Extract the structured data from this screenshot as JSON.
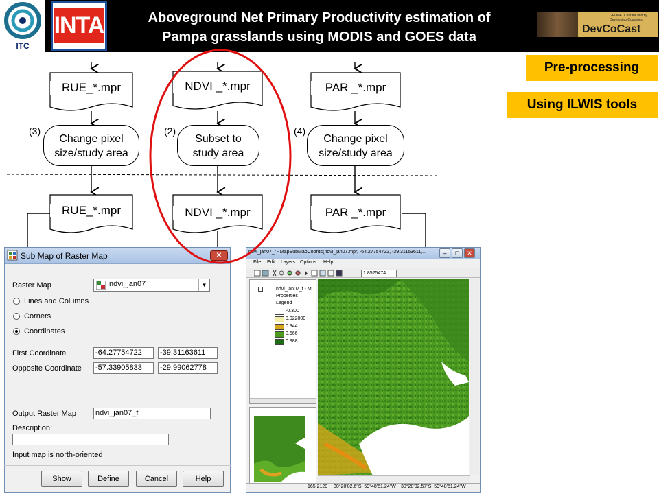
{
  "header": {
    "logo_left": "ITC",
    "logo_inta": "INTA",
    "title_line1": "Aboveground Net Primary Productivity estimation of",
    "title_line2": "Pampa grasslands using MODIS and GOES data",
    "devco_text": "DevCoCast",
    "devco_small1": "GEONETCast for and by",
    "devco_small2": "Developing Countries"
  },
  "tags": {
    "preprocessing": "Pre-processing",
    "ilwis": "Using ILWIS tools"
  },
  "flow": {
    "docs_top": [
      "RUE_*.mpr",
      "NDVI _*.mpr",
      "PAR _*.mpr"
    ],
    "process_numbers": [
      "(3)",
      "(2)",
      "(4)"
    ],
    "processes": [
      [
        "Change pixel",
        "size/study area"
      ],
      [
        "Subset  to",
        "study area"
      ],
      [
        "Change pixel",
        "size/study area"
      ]
    ],
    "docs_bottom": [
      "RUE_*.mpr",
      "NDVI _*.mpr",
      "PAR _*.mpr"
    ]
  },
  "submap": {
    "title": "Sub Map of Raster Map",
    "raster_map_label": "Raster Map",
    "raster_map_value": "ndvi_jan07",
    "radios": [
      "Lines and Columns",
      "Corners",
      "Coordinates"
    ],
    "selected_radio": 2,
    "first_coord_label": "First Coordinate",
    "first_coord_x": "-64.27754722",
    "first_coord_y": "-39.31163611",
    "opposite_coord_label": "Opposite Coordinate",
    "opposite_coord_x": "-57.33905833",
    "opposite_coord_y": "-29.99062778",
    "output_label": "Output Raster Map",
    "output_value": "ndvi_jan07_f",
    "description_label": "Description:",
    "description_value": "",
    "note": "Input map is north-oriented",
    "buttons": [
      "Show",
      "Define",
      "Cancel",
      "Help"
    ]
  },
  "mapwin": {
    "title": "ndvi_jan07_f - MapSubMapCoords(ndvi_jan07.mpr, -64.27754722, -39.31163611,...",
    "menu": [
      "File",
      "Edit",
      "Layers",
      "Options",
      "Help"
    ],
    "scale": "1:8525474",
    "tree_root": "ndvi_jan07_f - M",
    "tree_properties": "Properties",
    "tree_legend": "Legend",
    "legend": [
      {
        "value": "-0.300",
        "color": "#ffffff"
      },
      {
        "value": "0.022000",
        "color": "#f3efa8"
      },
      {
        "value": "0.344",
        "color": "#d8a61a"
      },
      {
        "value": "0.666",
        "color": "#4e9a1a"
      },
      {
        "value": "0.988",
        "color": "#1e6b16"
      }
    ],
    "status": [
      "165,2120",
      "30°20'02.6\"S, 59°48'51.24\"W",
      "30°20'02.57\"S, 59°48'51.24\"W"
    ]
  },
  "colors": {
    "header_bg": "#000000",
    "tag_bg": "#ffc000",
    "ellipse": "#e01010"
  }
}
